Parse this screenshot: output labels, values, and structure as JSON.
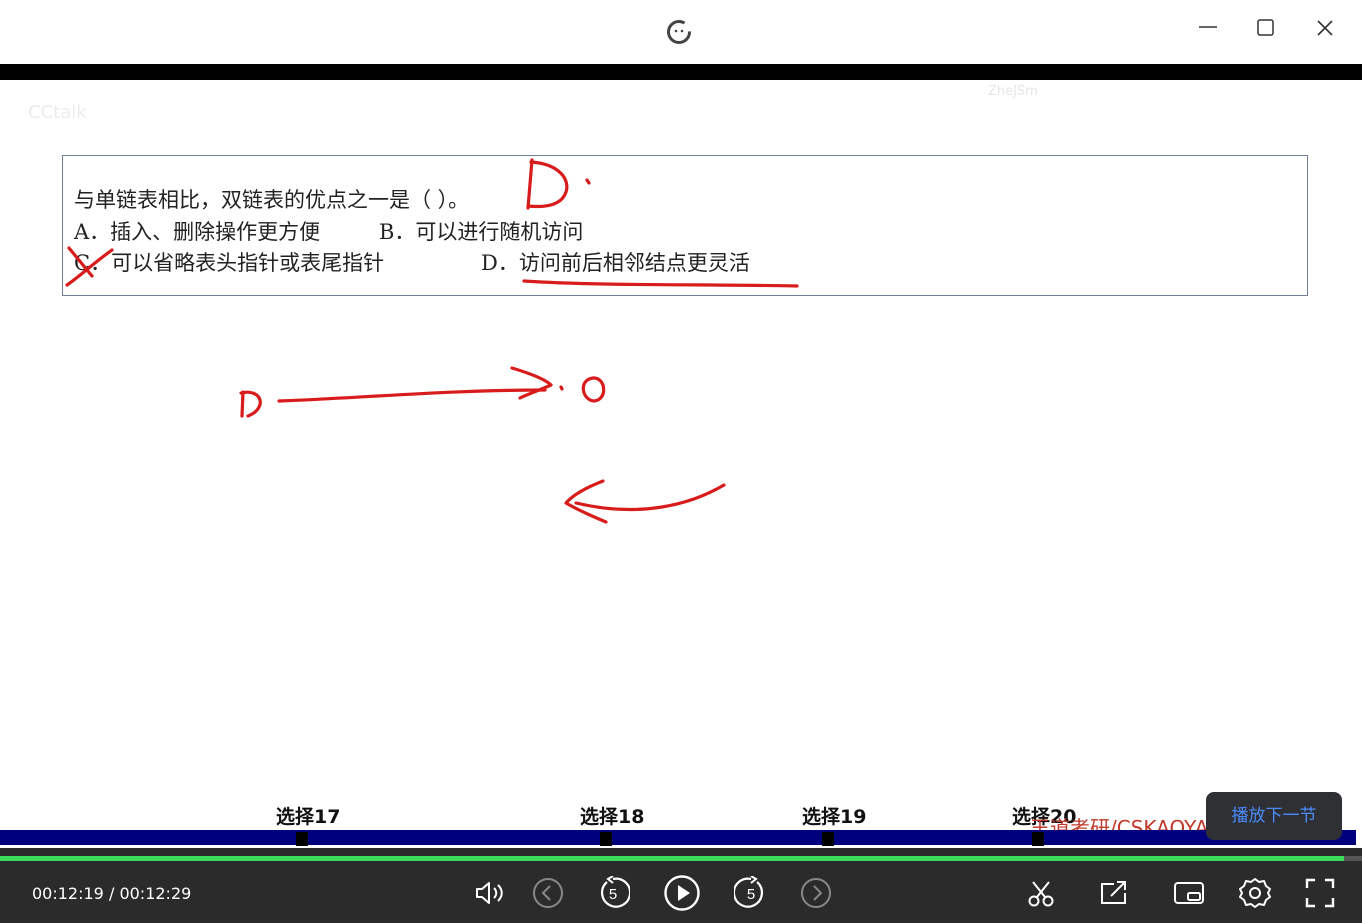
{
  "question": {
    "stem": "与单链表相比，双链表的优点之一是（      ）。",
    "option_a": "A．插入、删除操作更方便",
    "option_b": "B．可以进行随机访问",
    "option_c": "C．可以省略表头指针或表尾指针",
    "option_d": "D．访问前后相邻结点更灵活"
  },
  "watermarks": {
    "app": "CCtalk",
    "user": "ZheJSm"
  },
  "chapters": [
    "选择17",
    "选择18",
    "选择19",
    "选择20"
  ],
  "brand_text": "王道考研/CSKAOYAN.COM",
  "next_tip": "播放下一节",
  "player": {
    "current_time": "00:12:19",
    "separator": "/",
    "total_time": "00:12:29",
    "progress": 0.987
  },
  "icons": {
    "logo": "cctalk-logo-icon",
    "minimize": "minimize-icon",
    "maximize": "maximize-icon",
    "close": "close-icon",
    "volume": "volume-icon",
    "prev": "previous-icon",
    "rewind": "rewind-5-icon",
    "play": "play-icon",
    "forward": "forward-5-icon",
    "next": "next-icon",
    "clip": "scissors-icon",
    "share": "share-icon",
    "pip": "picture-in-picture-icon",
    "settings": "gear-icon",
    "fullscreen": "fullscreen-icon"
  },
  "colors": {
    "ink": "#d81b1b",
    "progress": "#3ddc5c",
    "bar_blue": "#00007e"
  }
}
